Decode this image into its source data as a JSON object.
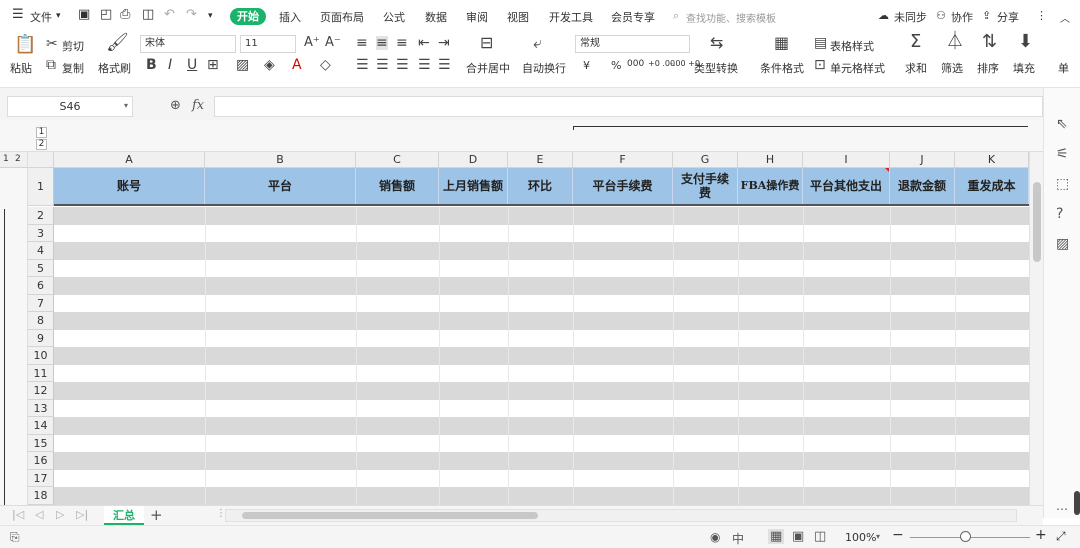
{
  "menu": {
    "file": "文件",
    "tabs": [
      "开始",
      "插入",
      "页面布局",
      "公式",
      "数据",
      "审阅",
      "视图",
      "开发工具",
      "会员专享"
    ],
    "search_placeholder": "查找功能、搜索模板",
    "sync": "未同步",
    "collab": "协作",
    "share": "分享"
  },
  "ribbon": {
    "paste": "粘贴",
    "cut": "剪切",
    "copy": "复制",
    "format_painter": "格式刷",
    "font_name": "宋体",
    "font_size": "11",
    "number_format": "常规",
    "merge": "合并居中",
    "wrap": "自动换行",
    "type_convert": "类型转换",
    "cond_format": "条件格式",
    "table_style": "表格样式",
    "cell_style": "单元格样式",
    "sum": "求和",
    "filter": "筛选",
    "sort": "排序",
    "fill": "填充",
    "more": "单",
    "currency": "¥",
    "percent": "%",
    "thousands": "000",
    "dec_inc": "+0 .00",
    "dec_dec": "-.00 +0"
  },
  "formula": {
    "cell_ref": "S46",
    "fx": "fx",
    "value": ""
  },
  "grid": {
    "outline_levels_top": [
      "1",
      "2"
    ],
    "outline_levels_left": [
      "1",
      "2"
    ],
    "columns": [
      "A",
      "B",
      "C",
      "D",
      "E",
      "F",
      "G",
      "H",
      "I",
      "J",
      "K"
    ],
    "header_row_number": "1",
    "headers": [
      "账号",
      "平台",
      "销售额",
      "上月销售额",
      "环比",
      "平台手续费",
      "支付手续费",
      "FBA操作费",
      "平台其他支出",
      "退款金额",
      "重发成本"
    ],
    "rows": [
      "2",
      "3",
      "4",
      "5",
      "6",
      "7",
      "8",
      "9",
      "10",
      "11",
      "12",
      "13",
      "14",
      "15",
      "16",
      "17",
      "18"
    ],
    "header_fill": "#9dc3e6",
    "stripe_fill": "#d9d9d9"
  },
  "sheets": {
    "tabs": [
      "汇总"
    ],
    "active_color": "#1bb36a"
  },
  "status": {
    "zoom": "100%",
    "zoom_level": 1.0
  }
}
